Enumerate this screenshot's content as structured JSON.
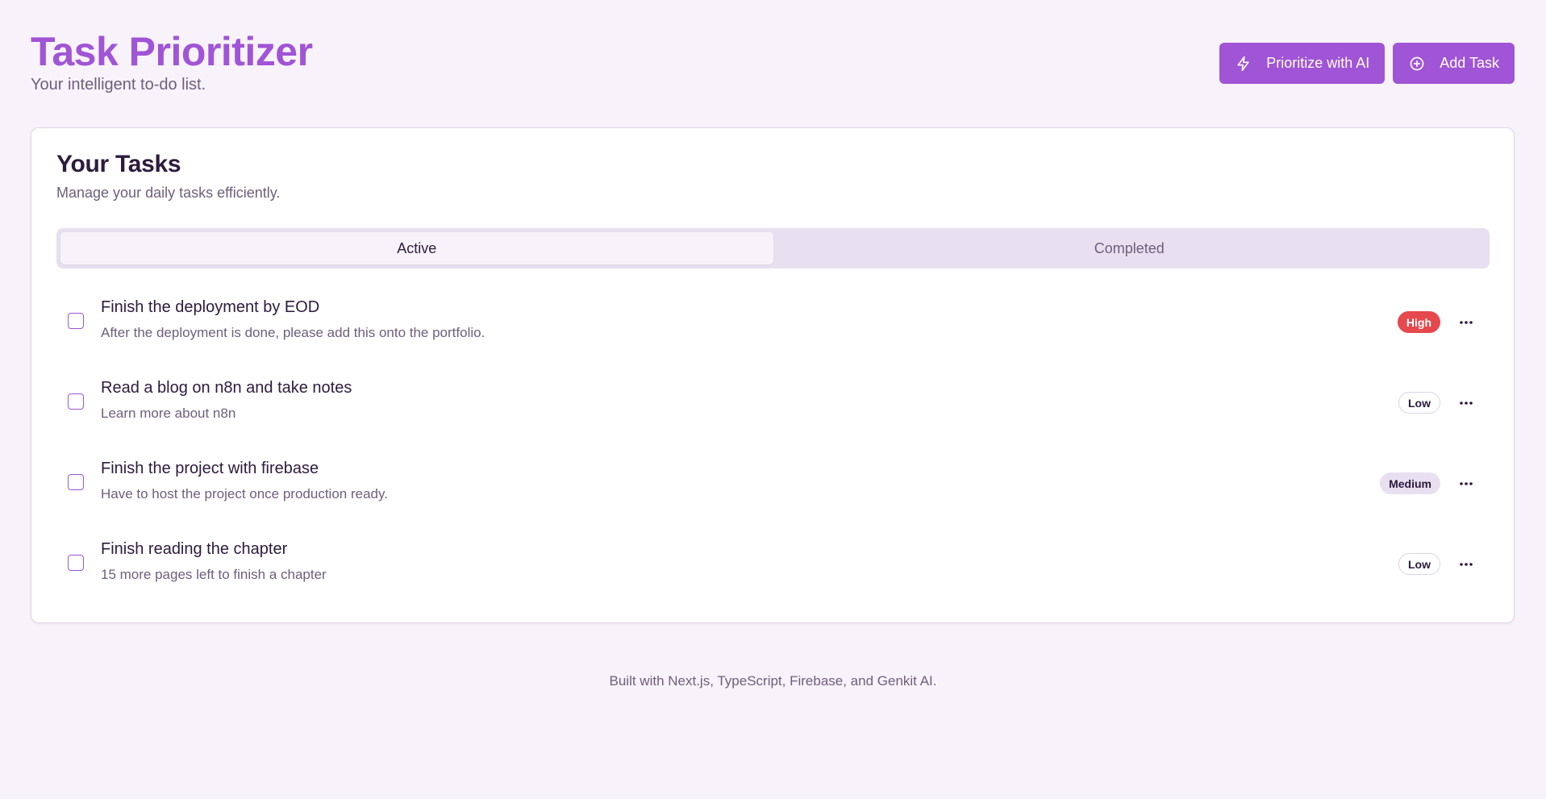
{
  "app": {
    "title": "Task Prioritizer",
    "subtitle": "Your intelligent to-do list."
  },
  "header_actions": {
    "prioritize_label": "Prioritize with AI",
    "prioritize_icon": "zap-icon",
    "add_label": "Add Task",
    "add_icon": "plus-circle-icon"
  },
  "card": {
    "title": "Your Tasks",
    "description": "Manage your daily tasks efficiently."
  },
  "tabs": [
    {
      "label": "Active",
      "active": true
    },
    {
      "label": "Completed",
      "active": false
    }
  ],
  "tasks": [
    {
      "title": "Finish the deployment by EOD",
      "description": "After the deployment is done, please add this onto the portfolio.",
      "priority": "High",
      "checked": false
    },
    {
      "title": "Read a blog on n8n and take notes",
      "description": "Learn more about n8n",
      "priority": "Low",
      "checked": false
    },
    {
      "title": "Finish the project with firebase",
      "description": "Have to host the project once production ready.",
      "priority": "Medium",
      "checked": false
    },
    {
      "title": "Finish reading the chapter",
      "description": "15 more pages left to finish a chapter",
      "priority": "Low",
      "checked": false
    }
  ],
  "footer": {
    "text": "Built with Next.js, TypeScript, Firebase, and Genkit AI."
  },
  "colors": {
    "accent": "#a054d6",
    "background": "#f8f3fa",
    "high": "#e5484d",
    "muted": "#6e5f7c"
  }
}
